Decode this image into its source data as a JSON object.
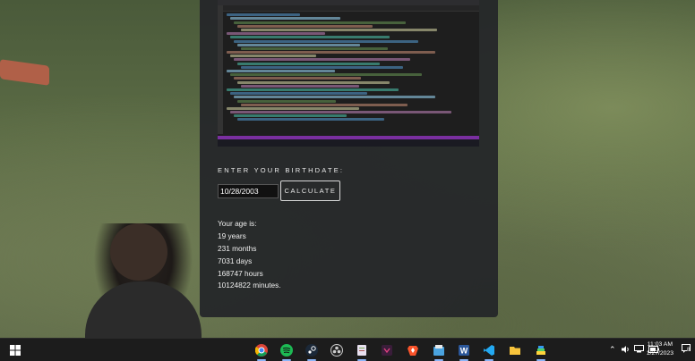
{
  "form": {
    "birthdate_label": "ENTER YOUR BIRTHDATE:",
    "birthdate_value": "10/28/2003",
    "calculate_label": "CALCULATE"
  },
  "results": {
    "heading": "Your age is:",
    "years": "19 years",
    "months": "231 months",
    "days": "7031 days",
    "hours": "168747 hours",
    "minutes": "10124822 minutes."
  },
  "taskbar": {
    "apps": [
      "chrome-icon",
      "spotify-icon",
      "steam-icon",
      "obs-icon",
      "notepad-icon",
      "app-icon",
      "brave-icon",
      "files-icon",
      "word-icon",
      "vscode-icon",
      "file-explorer-icon",
      "bluestacks-icon"
    ],
    "time": "11:03 AM",
    "date": "1/27/2023",
    "notification_count": "8"
  },
  "colors": {
    "panel": "#25282a",
    "accent_status": "#7a2fa0"
  }
}
